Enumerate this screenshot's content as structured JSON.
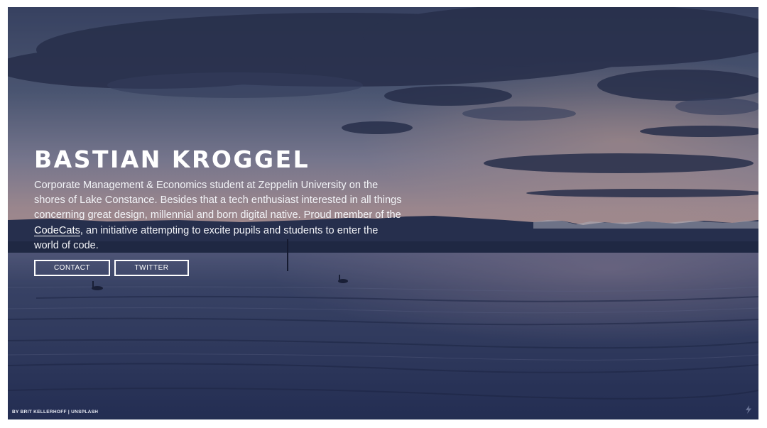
{
  "hero": {
    "name": "BASTIAN KROGGEL",
    "bio_before": "Corporate Management & Economics student at Zeppelin University on the shores of Lake Constance. Besides that a tech enthusiast interested in all things concerning great design, millennial and born digital native. Proud member of the ",
    "bio_link": "CodeCats",
    "bio_after": ", an initiative attempting to excite pupils and students to enter the world of code."
  },
  "buttons": {
    "contact": "CONTACT",
    "twitter": "TWITTER"
  },
  "credit": "BY BRIT KELLERHOFF | UNSPLASH",
  "background": {
    "scene": "lake-at-dusk-photo",
    "sky_top": "#3e4a6c",
    "sky_horizon": "#c3a3a2",
    "water": "#2c375a",
    "mountains": "#27314f"
  },
  "icons": {
    "corner": "lightning-icon"
  }
}
